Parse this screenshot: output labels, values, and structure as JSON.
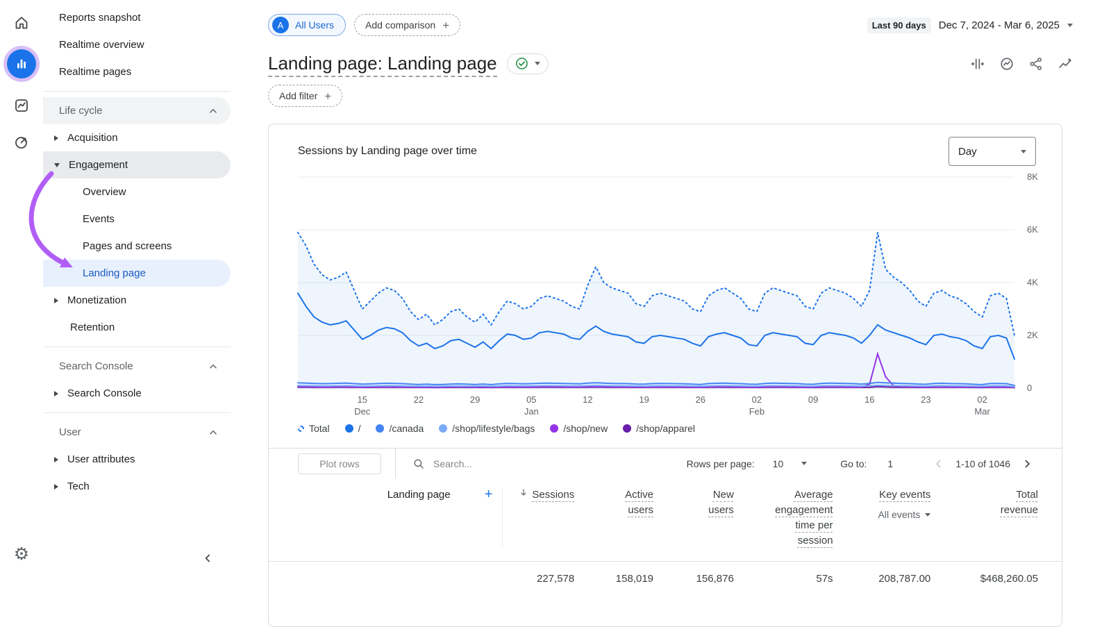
{
  "rail": {
    "icons": [
      "home",
      "reports",
      "explore",
      "advertising",
      "admin"
    ]
  },
  "sidebar": {
    "reports_snapshot": "Reports snapshot",
    "realtime_overview": "Realtime overview",
    "realtime_pages": "Realtime pages",
    "life_cycle": "Life cycle",
    "acquisition": "Acquisition",
    "engagement": "Engagement",
    "overview": "Overview",
    "events": "Events",
    "pages_and_screens": "Pages and screens",
    "landing_page": "Landing page",
    "monetization": "Monetization",
    "retention": "Retention",
    "search_console_header": "Search Console",
    "search_console_item": "Search Console",
    "user_header": "User",
    "user_attributes": "User attributes",
    "tech": "Tech"
  },
  "annotation": {
    "color": "#b15ef7"
  },
  "topbar": {
    "all_users_initial": "A",
    "all_users": "All Users",
    "add_comparison": "Add comparison",
    "date_range_label": "Last 90 days",
    "date_range": "Dec 7, 2024 - Mar 6, 2025"
  },
  "header": {
    "title": "Landing page: Landing page",
    "add_filter": "Add filter"
  },
  "card": {
    "chart_title": "Sessions by Landing page over time",
    "granularity": "Day"
  },
  "chart_data": {
    "type": "line",
    "title": "Sessions by Landing page over time",
    "x_start": "Dec 7, 2024",
    "x_end": "Mar 6, 2025",
    "x_unit": "day",
    "ylim": [
      0,
      8000
    ],
    "grid": "horizontal",
    "legend_position": "bottom",
    "yticks": [
      {
        "v": 8000,
        "label": "8K"
      },
      {
        "v": 6000,
        "label": "6K"
      },
      {
        "v": 4000,
        "label": "4K"
      },
      {
        "v": 2000,
        "label": "2K"
      },
      {
        "v": 0,
        "label": "0"
      }
    ],
    "xticks": [
      {
        "day": 8,
        "label": "15",
        "sub": "Dec"
      },
      {
        "day": 15,
        "label": "22"
      },
      {
        "day": 22,
        "label": "29"
      },
      {
        "day": 29,
        "label": "05",
        "sub": "Jan"
      },
      {
        "day": 36,
        "label": "12"
      },
      {
        "day": 43,
        "label": "19"
      },
      {
        "day": 50,
        "label": "26"
      },
      {
        "day": 57,
        "label": "02",
        "sub": "Feb"
      },
      {
        "day": 64,
        "label": "09"
      },
      {
        "day": 71,
        "label": "16"
      },
      {
        "day": 78,
        "label": "23"
      },
      {
        "day": 85,
        "label": "02",
        "sub": "Mar"
      }
    ],
    "series": [
      {
        "name": "Total",
        "color": "#1a73e8",
        "dashed": true,
        "fill": true,
        "values": [
          5900,
          5400,
          4700,
          4300,
          4100,
          4200,
          4400,
          3700,
          3000,
          3300,
          3600,
          3800,
          3700,
          3400,
          2900,
          2600,
          2800,
          2400,
          2600,
          2900,
          3000,
          2700,
          2500,
          2800,
          2400,
          2900,
          3300,
          3200,
          3000,
          3100,
          3400,
          3500,
          3400,
          3300,
          3100,
          3000,
          3900,
          4600,
          4000,
          3800,
          3700,
          3600,
          3200,
          3100,
          3500,
          3600,
          3500,
          3400,
          3300,
          3000,
          2900,
          3500,
          3700,
          3800,
          3600,
          3400,
          3000,
          2900,
          3600,
          3800,
          3700,
          3600,
          3500,
          3100,
          3000,
          3600,
          3800,
          3700,
          3600,
          3400,
          3100,
          3700,
          5900,
          4500,
          4200,
          4000,
          3700,
          3300,
          3100,
          3600,
          3700,
          3500,
          3400,
          3200,
          2900,
          2700,
          3500,
          3600,
          3400,
          2000
        ]
      },
      {
        "name": "/",
        "color": "#1a73e8",
        "values": [
          3600,
          3100,
          2700,
          2500,
          2400,
          2450,
          2550,
          2200,
          1850,
          2000,
          2200,
          2300,
          2250,
          2100,
          1800,
          1600,
          1700,
          1500,
          1600,
          1800,
          1850,
          1700,
          1550,
          1750,
          1500,
          1800,
          2050,
          2000,
          1850,
          1900,
          2100,
          2150,
          2100,
          2050,
          1900,
          1850,
          2150,
          2350,
          2150,
          2050,
          2000,
          1950,
          1750,
          1700,
          1950,
          2000,
          1950,
          1900,
          1850,
          1700,
          1600,
          1950,
          2050,
          2100,
          2000,
          1900,
          1650,
          1600,
          2000,
          2100,
          2050,
          2000,
          1950,
          1700,
          1650,
          2000,
          2100,
          2050,
          2000,
          1900,
          1700,
          2000,
          2400,
          2200,
          2100,
          2000,
          1900,
          1750,
          1650,
          2000,
          2050,
          1950,
          1900,
          1800,
          1600,
          1500,
          1950,
          2000,
          1900,
          1100
        ]
      },
      {
        "name": "/canada",
        "color": "#4285f4",
        "values": [
          200,
          190,
          180,
          170,
          175,
          185,
          190,
          170,
          150,
          160,
          175,
          185,
          180,
          170,
          150,
          140,
          150,
          135,
          140,
          155,
          160,
          150,
          140,
          155,
          135,
          160,
          180,
          175,
          165,
          170,
          185,
          190,
          185,
          180,
          170,
          165,
          190,
          205,
          190,
          180,
          175,
          170,
          155,
          150,
          170,
          180,
          175,
          170,
          165,
          150,
          140,
          175,
          185,
          190,
          180,
          170,
          150,
          145,
          180,
          190,
          185,
          180,
          175,
          150,
          145,
          180,
          190,
          185,
          180,
          170,
          150,
          180,
          215,
          200,
          190,
          180,
          170,
          155,
          145,
          180,
          185,
          175,
          170,
          160,
          145,
          135,
          175,
          180,
          170,
          100
        ]
      },
      {
        "name": "/shop/lifestyle/bags",
        "color": "#7baaf7",
        "values": [
          100,
          95,
          90,
          85,
          88,
          92,
          95,
          85,
          75,
          80,
          88,
          92,
          90,
          85,
          75,
          70,
          75,
          68,
          70,
          78,
          80,
          75,
          70,
          78,
          68,
          80,
          90,
          88,
          83,
          85,
          92,
          95,
          92,
          90,
          85,
          83,
          95,
          102,
          95,
          90,
          88,
          85,
          78,
          75,
          85,
          90,
          88,
          85,
          83,
          75,
          70,
          88,
          92,
          95,
          90,
          85,
          75,
          73,
          90,
          95,
          92,
          90,
          88,
          75,
          73,
          90,
          95,
          92,
          90,
          85,
          75,
          90,
          108,
          100,
          95,
          90,
          85,
          78,
          73,
          90,
          92,
          88,
          85,
          80,
          73,
          68,
          88,
          90,
          85,
          50
        ]
      },
      {
        "name": "/shop/new",
        "color": "#9334e6",
        "values": [
          60,
          55,
          50,
          48,
          50,
          52,
          55,
          48,
          40,
          45,
          50,
          52,
          50,
          48,
          42,
          38,
          42,
          36,
          40,
          44,
          46,
          42,
          38,
          44,
          36,
          46,
          52,
          50,
          47,
          48,
          52,
          55,
          52,
          50,
          47,
          46,
          55,
          60,
          55,
          52,
          50,
          48,
          44,
          42,
          48,
          52,
          50,
          48,
          47,
          42,
          38,
          50,
          52,
          55,
          52,
          48,
          42,
          40,
          52,
          55,
          52,
          50,
          48,
          42,
          40,
          52,
          55,
          52,
          50,
          48,
          42,
          150,
          1300,
          420,
          90,
          60,
          55,
          48,
          42,
          52,
          55,
          50,
          48,
          45,
          40,
          36,
          50,
          52,
          48,
          28
        ]
      },
      {
        "name": "/shop/apparel",
        "color": "#681da8",
        "values": [
          40,
          38,
          35,
          33,
          34,
          36,
          38,
          33,
          28,
          30,
          34,
          36,
          35,
          33,
          28,
          26,
          28,
          24,
          27,
          30,
          31,
          28,
          26,
          30,
          25,
          31,
          35,
          34,
          32,
          33,
          36,
          37,
          36,
          35,
          32,
          31,
          37,
          40,
          37,
          35,
          34,
          33,
          30,
          28,
          33,
          35,
          34,
          33,
          32,
          28,
          26,
          34,
          36,
          37,
          35,
          33,
          28,
          27,
          35,
          37,
          36,
          35,
          34,
          28,
          27,
          35,
          37,
          36,
          35,
          33,
          28,
          35,
          60,
          45,
          38,
          35,
          33,
          30,
          27,
          35,
          36,
          34,
          33,
          31,
          27,
          25,
          34,
          35,
          33,
          18
        ]
      }
    ]
  },
  "table": {
    "plot_rows": "Plot rows",
    "search_placeholder": "Search...",
    "rows_per_page_label": "Rows per page:",
    "rows_per_page": "10",
    "goto_label": "Go to:",
    "goto_value": "1",
    "pagination_range": "1-10 of 1046",
    "dimension_header": "Landing page",
    "columns": [
      {
        "label": "Sessions",
        "sorted": "desc"
      },
      {
        "label": "Active users"
      },
      {
        "label": "New users"
      },
      {
        "label": "Average engagement time per session"
      },
      {
        "label": "Key events",
        "filter": "All events"
      },
      {
        "label": "Total revenue"
      }
    ],
    "totals": [
      "227,578",
      "158,019",
      "156,876",
      "57s",
      "208,787.00",
      "$468,260.05"
    ]
  }
}
